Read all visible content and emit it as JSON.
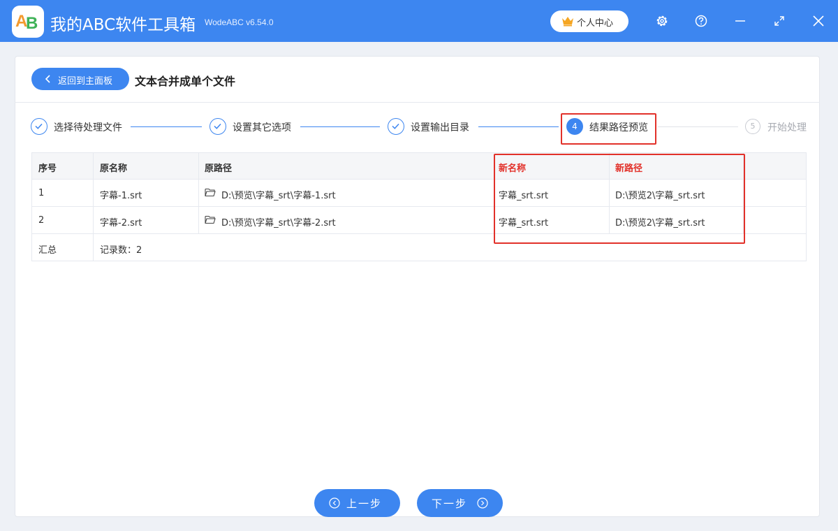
{
  "app": {
    "title": "我的ABC软件工具箱",
    "version": "WodeABC v6.54.0",
    "logo_text_a": "A",
    "logo_text_b": "B",
    "user_center_label": "个人中心"
  },
  "titlebar_icons": [
    "gear-icon",
    "help-icon",
    "minimize-icon",
    "maximize-icon",
    "close-icon"
  ],
  "header": {
    "back_label": "返回到主面板",
    "page_title": "文本合并成单个文件"
  },
  "steps": [
    {
      "label": "选择待处理文件",
      "state": "done"
    },
    {
      "label": "设置其它选项",
      "state": "done"
    },
    {
      "label": "设置输出目录",
      "state": "done"
    },
    {
      "number": "4",
      "label": "结果路径预览",
      "state": "active"
    },
    {
      "number": "5",
      "label": "开始处理",
      "state": "pending"
    }
  ],
  "table": {
    "columns": [
      "序号",
      "原名称",
      "原路径",
      "新名称",
      "新路径"
    ],
    "rows": [
      [
        "1",
        "字幕-1.srt",
        "D:\\预览\\字幕_srt\\字幕-1.srt",
        "字幕_srt.srt",
        "D:\\预览2\\字幕_srt.srt"
      ],
      [
        "2",
        "字幕-2.srt",
        "D:\\预览\\字幕_srt\\字幕-2.srt",
        "字幕_srt.srt",
        "D:\\预览2\\字幕_srt.srt"
      ]
    ],
    "summary_label": "汇总",
    "summary_value": "记录数：2"
  },
  "footer": {
    "prev_label": "上一步",
    "next_label": "下一步"
  },
  "colors": {
    "accent": "#3d86f0",
    "highlight": "#e2312a"
  }
}
